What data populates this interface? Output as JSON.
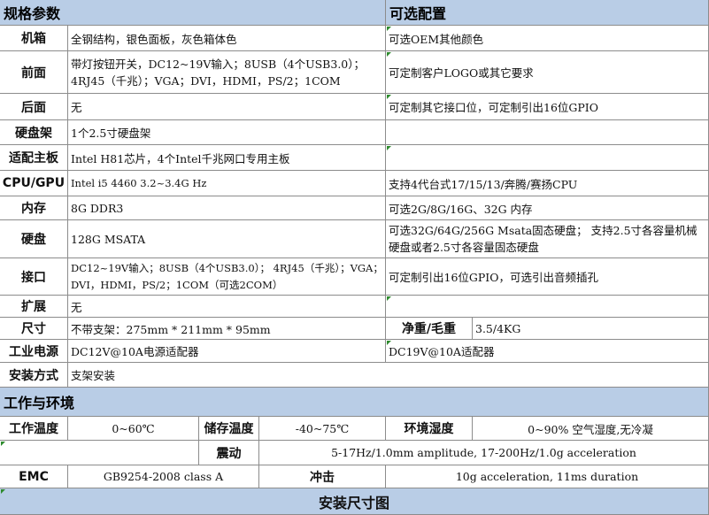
{
  "headers": {
    "spec": "规格参数",
    "optional": "可选配置",
    "environment": "工作与环境",
    "install_drawing": "安装尺寸图"
  },
  "specs": [
    {
      "label": "机箱",
      "value": "全钢结构，银色面板，灰色箱体色",
      "option": "可选OEM其他颜色"
    },
    {
      "label": "前面",
      "value": "带灯按钮开关，DC12~19V输入；8USB（4个USB3.0）；4RJ45（千兆）；VGA；DVI，HDMI，PS/2；1COM",
      "option": "可定制客户LOGO或其它要求"
    },
    {
      "label": "后面",
      "value": "无",
      "option": "可定制其它接口位，可定制引出16位GPIO"
    },
    {
      "label": "硬盘架",
      "value": "1个2.5寸硬盘架",
      "option": ""
    },
    {
      "label": "适配主板",
      "value": "Intel H81芯片，4个Intel千兆网口专用主板",
      "option": ""
    },
    {
      "label": "CPU/GPU",
      "value": "Intel i5 4460 3.2~3.4G Hz",
      "option": "支持4代台式17/15/13/奔腾/赛扬CPU"
    },
    {
      "label": "内存",
      "value": "8G DDR3",
      "option": "可选2G/8G/16G、32G 内存"
    },
    {
      "label": "硬盘",
      "value": "128G MSATA",
      "option": "可选32G/64G/256G Msata固态硬盘； 支持2.5寸各容量机械硬盘或者2.5寸各容量固态硬盘"
    },
    {
      "label": "接口",
      "value": "DC12~19V输入；8USB（4个USB3.0）； 4RJ45（千兆）；VGA；DVI，HDMI，PS/2；1COM（可选2COM）",
      "option": "可定制引出16位GPIO，可选引出音频插孔"
    },
    {
      "label": "扩展",
      "value": "无",
      "option": ""
    }
  ],
  "size_row": {
    "label": "尺寸",
    "value": "不带支架：275mm  * 211mm * 95mm",
    "weight_label": "净重/毛重",
    "weight_value": "3.5/4KG"
  },
  "power_row": {
    "label": "工业电源",
    "value": "DC12V@10A电源适配器",
    "option": "DC19V@10A适配器"
  },
  "install_row": {
    "label": "安装方式",
    "value": "支架安装"
  },
  "env": {
    "op_temp_label": "工作温度",
    "op_temp_value": "0~60℃",
    "storage_temp_label": "储存温度",
    "storage_temp_value": "-40~75℃",
    "humidity_label": "环境湿度",
    "humidity_value": "0~90% 空气湿度,无冷凝",
    "vibration_label": "震动",
    "vibration_value": "5-17Hz/1.0mm amplitude, 17-200Hz/1.0g acceleration",
    "emc_label": "EMC",
    "emc_value": "GB9254-2008 class A",
    "shock_label": "冲击",
    "shock_value": "10g acceleration, 11ms duration"
  },
  "accent_color": "#b9cde6",
  "marker_color": "#2e8b2e"
}
